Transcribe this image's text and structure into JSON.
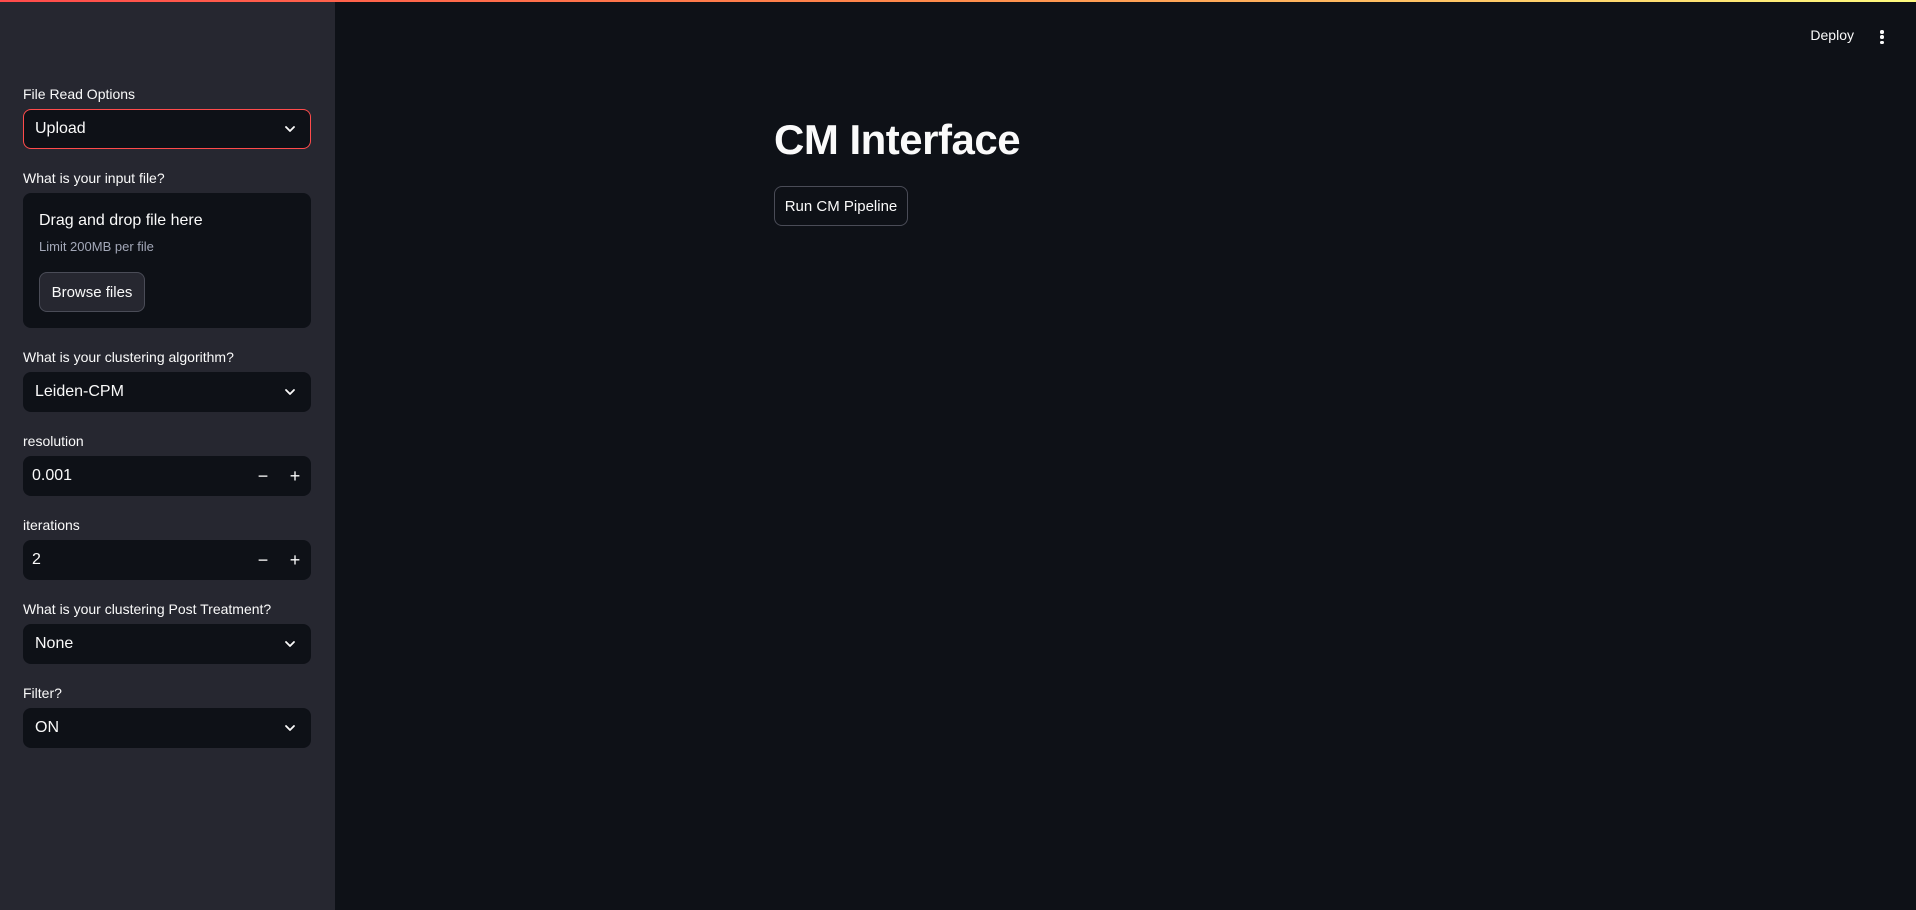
{
  "header": {
    "deploy_label": "Deploy",
    "menu_icon": "kebab-menu-icon"
  },
  "sidebar": {
    "file_read": {
      "label": "File Read Options",
      "value": "Upload"
    },
    "input_file": {
      "label": "What is your input file?",
      "dropzone_title": "Drag and drop file here",
      "dropzone_limit": "Limit 200MB per file",
      "browse_label": "Browse files"
    },
    "algorithm": {
      "label": "What is your clustering algorithm?",
      "value": "Leiden-CPM"
    },
    "resolution": {
      "label": "resolution",
      "value": "0.001",
      "minus": "−",
      "plus": "+"
    },
    "iterations": {
      "label": "iterations",
      "value": "2",
      "minus": "−",
      "plus": "+"
    },
    "post_treatment": {
      "label": "What is your clustering Post Treatment?",
      "value": "None"
    },
    "filter": {
      "label": "Filter?",
      "value": "ON"
    }
  },
  "main": {
    "title": "CM Interface",
    "run_button": "Run CM Pipeline"
  },
  "colors": {
    "background": "#0e1117",
    "sidebar": "#262730",
    "accent": "#ff4b4b",
    "text": "#fafafa"
  }
}
